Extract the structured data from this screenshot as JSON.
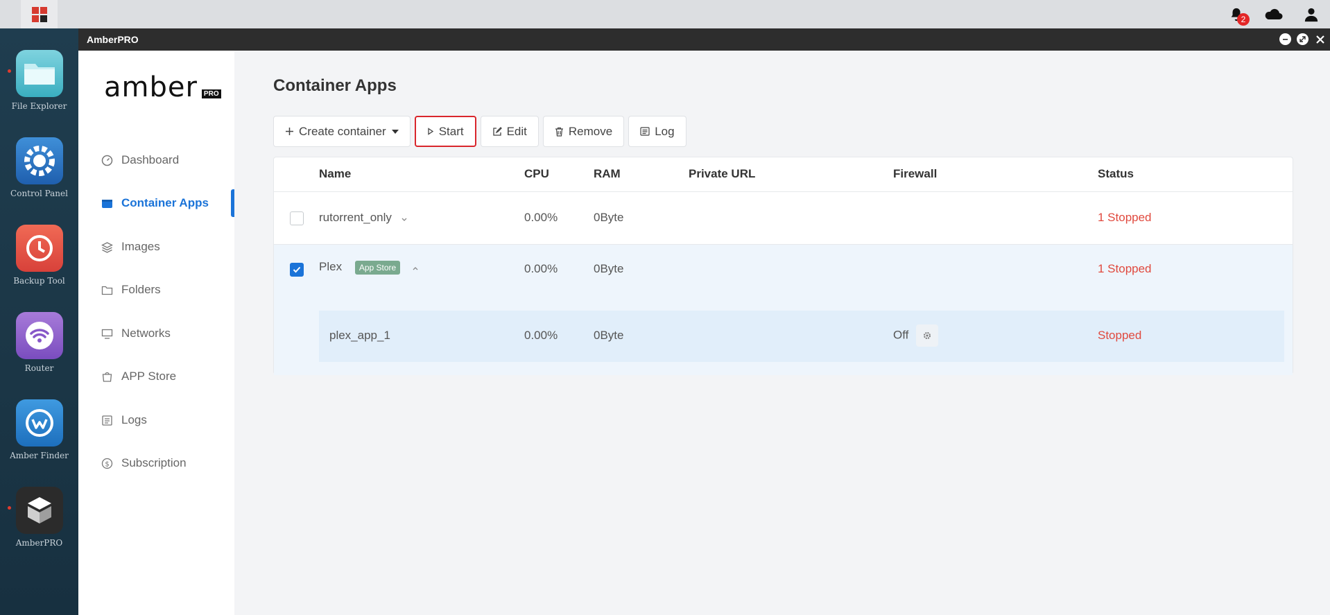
{
  "system_bar": {
    "notification_count": "2"
  },
  "dock": {
    "items": [
      {
        "label": "File Explorer"
      },
      {
        "label": "Control Panel"
      },
      {
        "label": "Backup Tool"
      },
      {
        "label": "Router"
      },
      {
        "label": "Amber Finder"
      },
      {
        "label": "AmberPRO"
      }
    ]
  },
  "window": {
    "title": "AmberPRO"
  },
  "sidebar": {
    "logo_text": "amber",
    "logo_badge": "PRO",
    "items": [
      {
        "label": "Dashboard",
        "icon": "dashboard-icon"
      },
      {
        "label": "Container Apps",
        "icon": "container-icon",
        "active": true
      },
      {
        "label": "Images",
        "icon": "layers-icon"
      },
      {
        "label": "Folders",
        "icon": "folder-icon"
      },
      {
        "label": "Networks",
        "icon": "monitor-icon"
      },
      {
        "label": "APP Store",
        "icon": "store-icon"
      },
      {
        "label": "Logs",
        "icon": "logs-icon"
      },
      {
        "label": "Subscription",
        "icon": "dollar-icon"
      }
    ]
  },
  "main": {
    "title": "Container Apps",
    "toolbar": {
      "create": "Create container",
      "start": "Start",
      "edit": "Edit",
      "remove": "Remove",
      "log": "Log"
    },
    "table": {
      "headers": {
        "name": "Name",
        "cpu": "CPU",
        "ram": "RAM",
        "private_url": "Private URL",
        "firewall": "Firewall",
        "status": "Status"
      },
      "rows": [
        {
          "name": "rutorrent_only",
          "cpu": "0.00%",
          "ram": "0Byte",
          "status": "1 Stopped",
          "checked": false
        },
        {
          "name": "Plex",
          "tag": "App Store",
          "cpu": "0.00%",
          "ram": "0Byte",
          "status": "1 Stopped",
          "checked": true,
          "children": [
            {
              "name": "plex_app_1",
              "cpu": "0.00%",
              "ram": "0Byte",
              "firewall": "Off",
              "status": "Stopped"
            }
          ]
        }
      ]
    }
  },
  "colors": {
    "accent": "#1a73d8",
    "stopped": "#e0493e",
    "highlight_border": "#d9262c",
    "tag": "#7aaa8f"
  }
}
